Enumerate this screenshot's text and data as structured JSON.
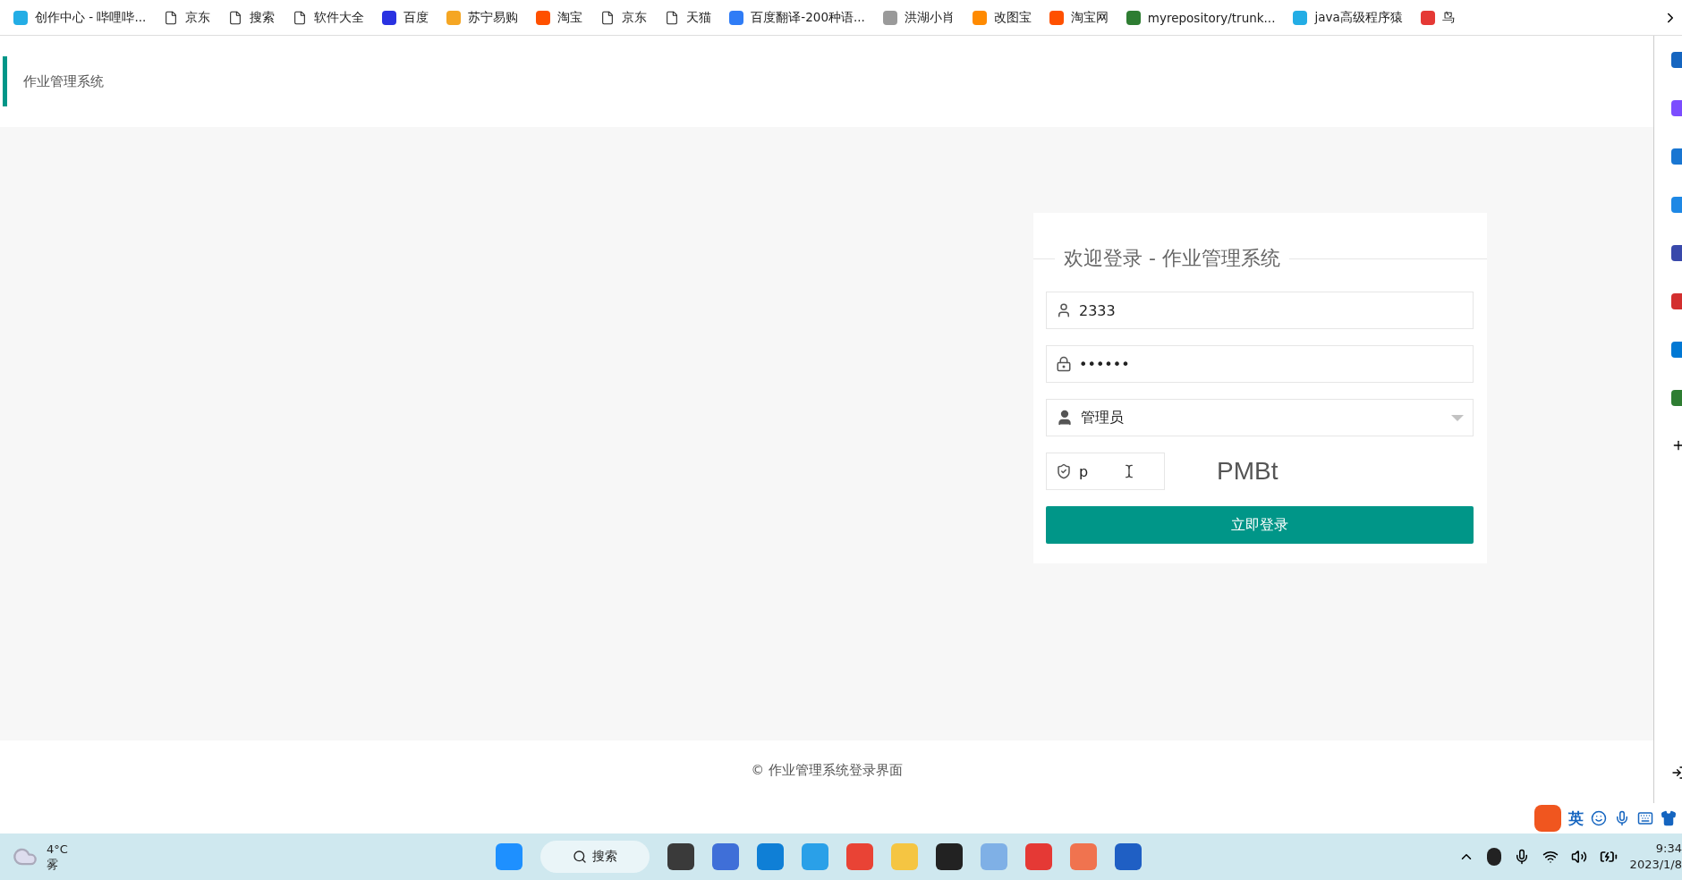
{
  "bookmarks": [
    {
      "label": "创作中心 - 哔哩哔...",
      "kind": "site",
      "color": "#23ade5"
    },
    {
      "label": "京东",
      "kind": "page"
    },
    {
      "label": "搜索",
      "kind": "page"
    },
    {
      "label": "软件大全",
      "kind": "page"
    },
    {
      "label": "百度",
      "kind": "site",
      "color": "#2932e1"
    },
    {
      "label": "苏宁易购",
      "kind": "site",
      "color": "#f5a623"
    },
    {
      "label": "淘宝",
      "kind": "site",
      "color": "#ff5000"
    },
    {
      "label": "京东",
      "kind": "page"
    },
    {
      "label": "天猫",
      "kind": "page"
    },
    {
      "label": "百度翻译-200种语...",
      "kind": "site",
      "color": "#2f7cf6"
    },
    {
      "label": "洪湖小肖",
      "kind": "site",
      "color": "#9a9a9a"
    },
    {
      "label": "改图宝",
      "kind": "site",
      "color": "#ff8a00"
    },
    {
      "label": "淘宝网",
      "kind": "site",
      "color": "#ff5000"
    },
    {
      "label": "myrepository/trunk...",
      "kind": "site",
      "color": "#2e7d32"
    },
    {
      "label": "java高级程序猿",
      "kind": "site",
      "color": "#23ade5"
    },
    {
      "label": "鸟",
      "kind": "site",
      "color": "#e53935"
    }
  ],
  "header": {
    "title": "作业管理系统"
  },
  "login": {
    "legend": "欢迎登录 - 作业管理系统",
    "username": {
      "value": "2333"
    },
    "password": {
      "value": "••••••"
    },
    "role": {
      "value": "管理员"
    },
    "captcha": {
      "value": "p",
      "code": "PMBt"
    },
    "submit": "立即登录"
  },
  "footer": "© 作业管理系统登录界面",
  "ime": {
    "mode": "英"
  },
  "taskbar": {
    "temperature": "4°C",
    "weather": "雾",
    "search": "搜索",
    "time": "9:34",
    "date": "2023/1/8"
  }
}
